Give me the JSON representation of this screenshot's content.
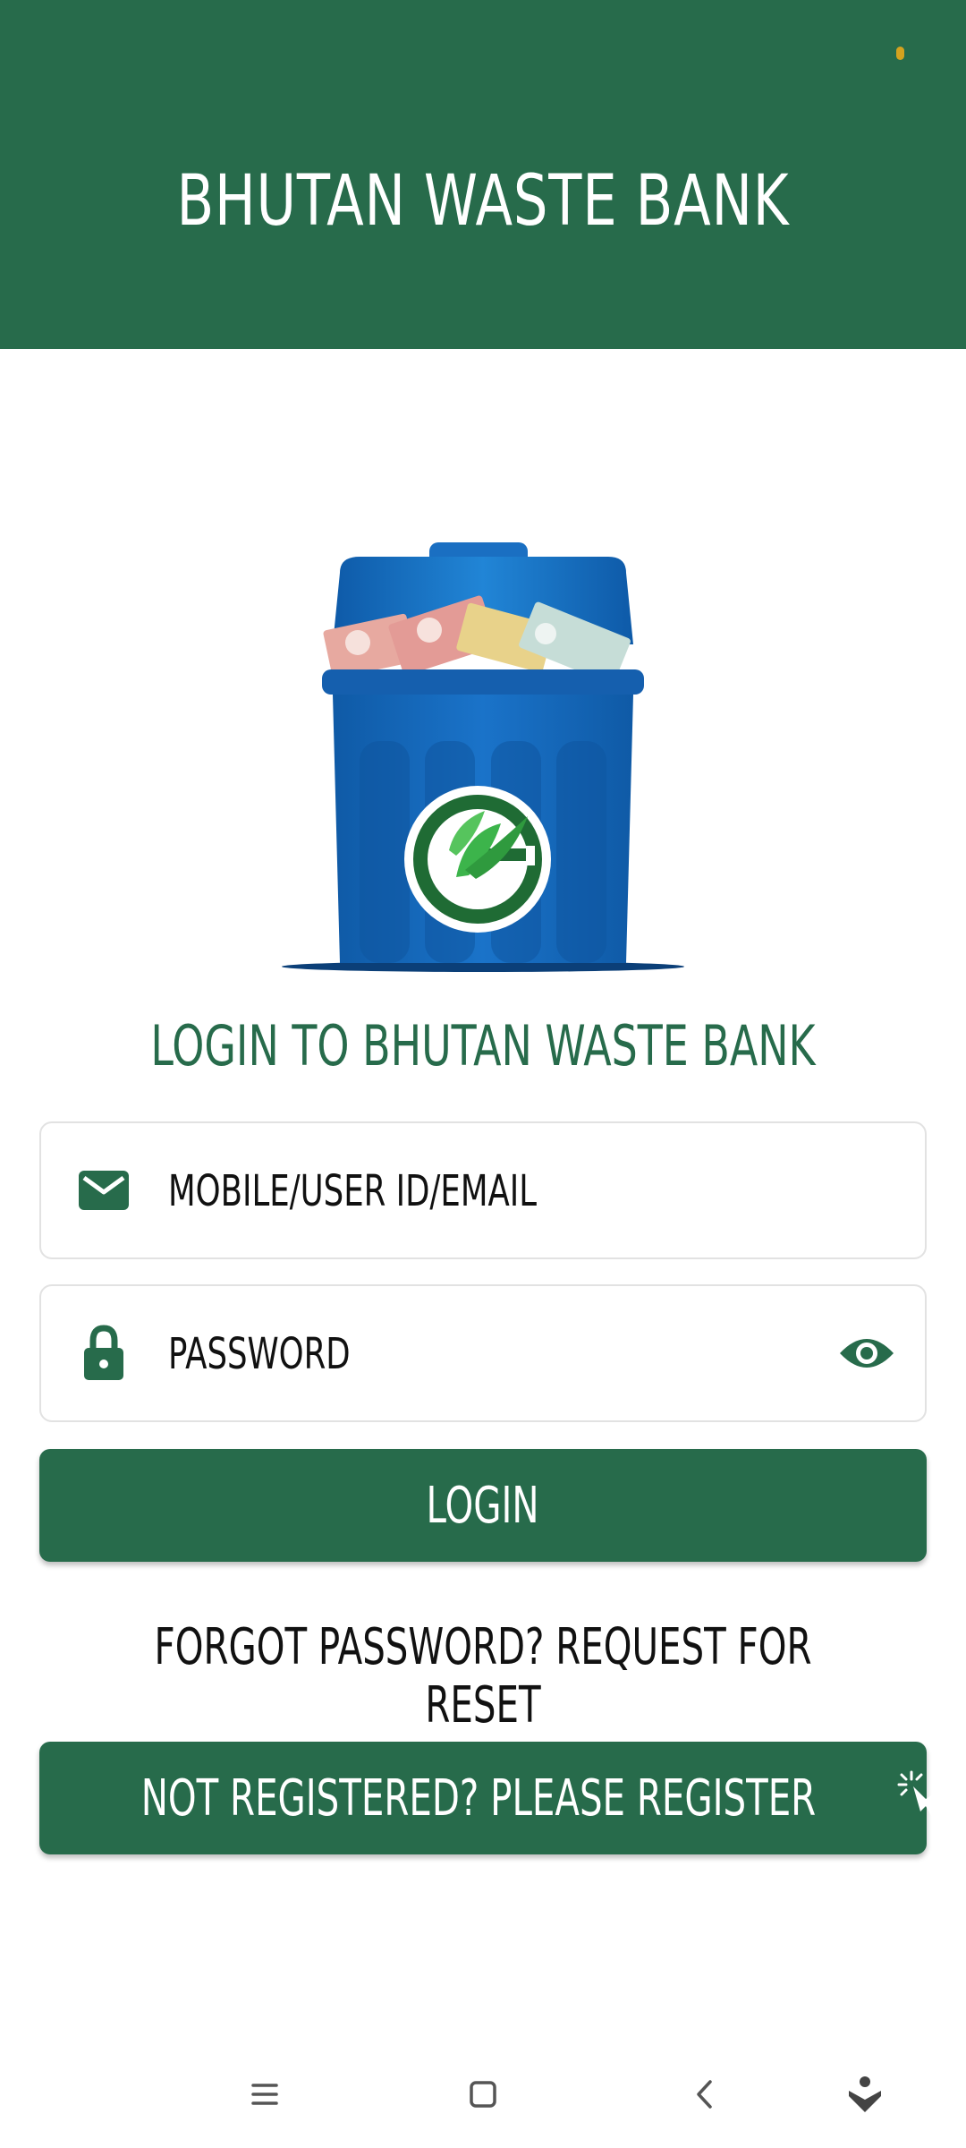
{
  "header": {
    "title": "BHUTAN WASTE BANK"
  },
  "login": {
    "heading": "LOGIN TO BHUTAN WASTE BANK",
    "user_placeholder": "MOBILE/USER ID/EMAIL",
    "password_placeholder": "PASSWORD",
    "login_label": "LOGIN",
    "forgot_label": "FORGOT PASSWORD? REQUEST FOR RESET",
    "register_label": "NOT REGISTERED? PLEASE REGISTER"
  },
  "icons": {
    "user_field": "mail-icon",
    "password_field": "lock-icon",
    "toggle_visibility": "eye-icon",
    "register": "tap-hand-icon",
    "nav": [
      "menu-icon",
      "home-square-icon",
      "back-icon",
      "assistant-icon"
    ]
  },
  "colors": {
    "brand_green": "#276b4b",
    "bin_blue": "#1464b4",
    "text": "#111111"
  }
}
